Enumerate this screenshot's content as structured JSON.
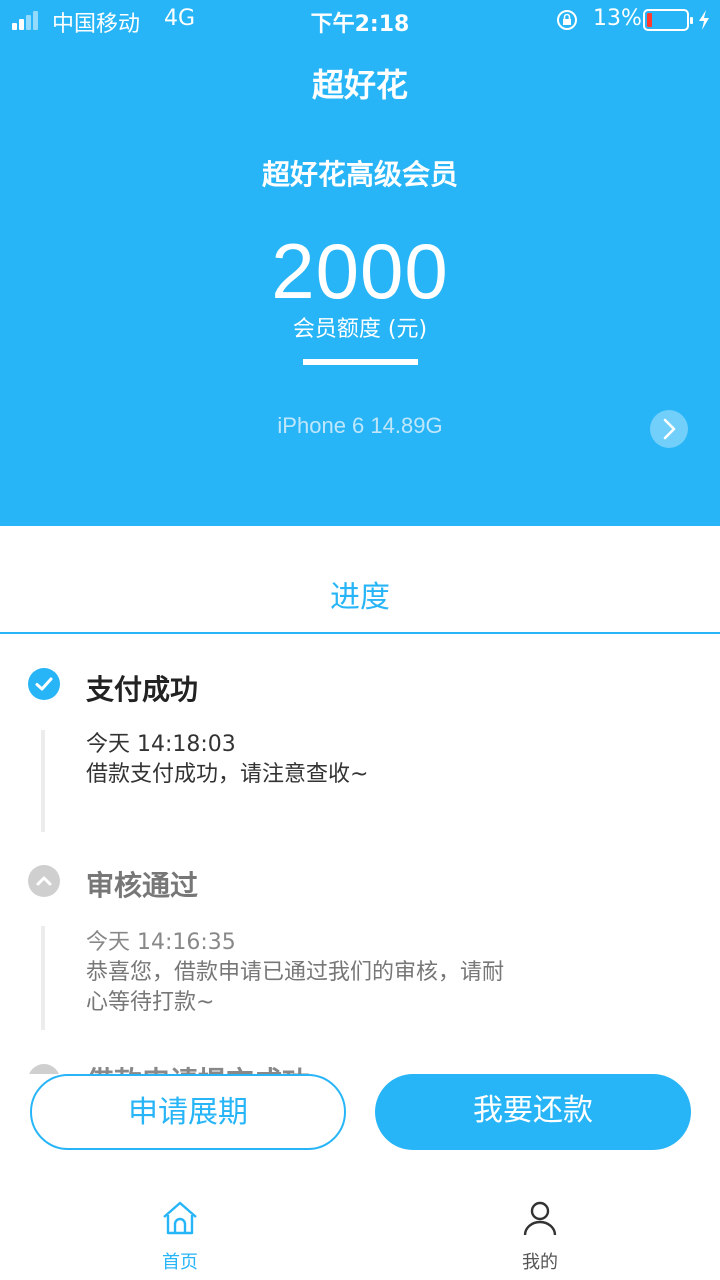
{
  "status_bar": {
    "carrier": "中国移动",
    "network": "4G",
    "time": "下午2:18",
    "battery_percent": "13%",
    "battery_level": 0.13,
    "battery_color": "#ff3b30"
  },
  "header": {
    "title": "超好花",
    "member_level": "超好花高级会员",
    "amount": "2000",
    "amount_label": "会员额度 (元)",
    "device": "iPhone 6  14.89G"
  },
  "progress": {
    "title": "进度",
    "steps": [
      {
        "title": "支付成功",
        "time": "今天 14:18:03",
        "desc": "借款支付成功，请注意查收~",
        "status": "done",
        "icon": "check-icon"
      },
      {
        "title": "审核通过",
        "time": "今天 14:16:35",
        "desc_line1": "恭喜您，借款申请已通过我们的审核，请耐",
        "desc_line2": "心等待打款~",
        "status": "past",
        "icon": "chevron-up-icon"
      },
      {
        "title": "借款申请提交成功",
        "status": "past",
        "icon": "chevron-up-icon"
      }
    ]
  },
  "actions": {
    "extend_label": "申请展期",
    "repay_label": "我要还款"
  },
  "tabbar": {
    "home_label": "首页",
    "mine_label": "我的"
  },
  "colors": {
    "brand": "#27b5f7",
    "header_bg": "#27b5f7"
  }
}
